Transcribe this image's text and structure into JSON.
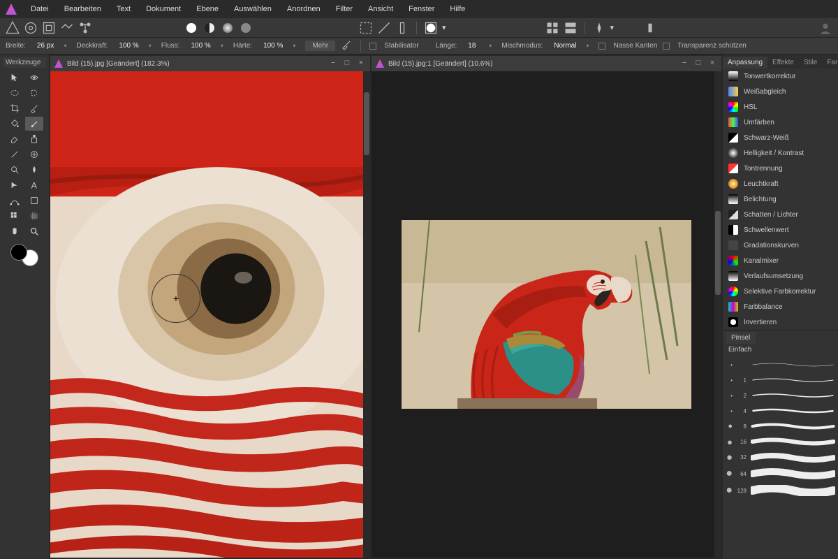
{
  "menu": {
    "items": [
      "Datei",
      "Bearbeiten",
      "Text",
      "Dokument",
      "Ebene",
      "Auswählen",
      "Anordnen",
      "Filter",
      "Ansicht",
      "Fenster",
      "Hilfe"
    ]
  },
  "context": {
    "width_label": "Breite:",
    "width_value": "26 px",
    "opacity_label": "Deckkraft:",
    "opacity_value": "100 %",
    "flow_label": "Fluss:",
    "flow_value": "100 %",
    "hardness_label": "Härte:",
    "hardness_value": "100 %",
    "more": "Mehr",
    "stabilizer": "Stabilisator",
    "length_label": "Länge:",
    "length_value": "18",
    "blend_label": "Mischmodus:",
    "blend_value": "Normal",
    "wet_edges": "Nasse Kanten",
    "protect_alpha": "Transparenz schützen"
  },
  "tools_title": "Werkzeuge",
  "doc1": {
    "title": "Bild (15).jpg [Geändert] (182.3%)"
  },
  "doc2": {
    "title": "Bild (15).jpg:1 [Geändert] (10.6%)"
  },
  "panel": {
    "tabs": [
      "Anpassung",
      "Effekte",
      "Stile",
      "Farbfelder"
    ],
    "adjustments": [
      "Tonwertkorrektur",
      "Weißabgleich",
      "HSL",
      "Umfärben",
      "Schwarz-Weiß",
      "Helligkeit / Kontrast",
      "Tontrennung",
      "Leuchtkraft",
      "Belichtung",
      "Schatten / Lichter",
      "Schwellenwert",
      "Gradationskurven",
      "Kanalmixer",
      "Verlaufsumsetzung",
      "Selektive Farbkorrektur",
      "Farbbalance",
      "Invertieren"
    ],
    "brush_tab": "Pinsel",
    "brush_category": "Einfach",
    "brush_sizes": [
      "",
      "1",
      "2",
      "4",
      "8",
      "16",
      "32",
      "64",
      "128"
    ]
  }
}
